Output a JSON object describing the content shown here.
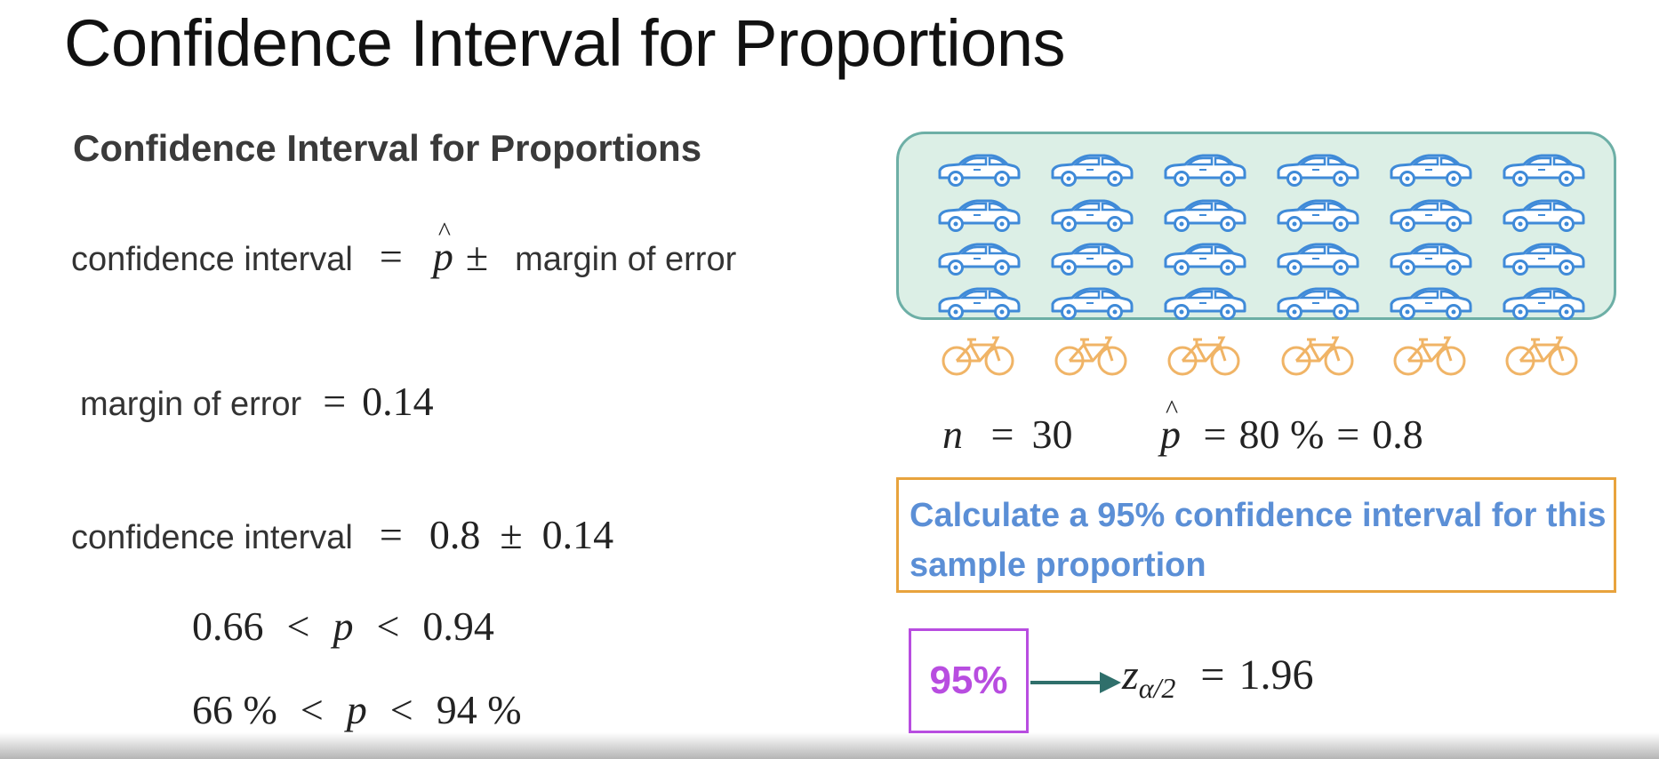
{
  "slide": {
    "title": "Confidence Interval for Proportions",
    "section_heading": "Confidence Interval for Proportions"
  },
  "formulas": {
    "ci_formula": {
      "lhs": "confidence interval",
      "eq": "=",
      "phat": "p",
      "pm": "±",
      "rhs": "margin of error"
    },
    "moe": {
      "lhs": "margin of error",
      "eq": "=",
      "value": "0.14"
    },
    "ci_values": {
      "lhs": "confidence interval",
      "eq": "=",
      "point": "0.8",
      "pm": "±",
      "moe": "0.14"
    },
    "ineq_decimal": {
      "lower": "0.66",
      "lt1": "<",
      "var": "p",
      "lt2": "<",
      "upper": "0.94"
    },
    "ineq_percent": {
      "lower": "66 %",
      "lt1": "<",
      "var": "p",
      "lt2": "<",
      "upper": "94 %"
    }
  },
  "sample": {
    "cars": 24,
    "bikes": 6,
    "car_icon": "car-icon",
    "bike_icon": "bicycle-icon",
    "car_color": "#3f8ad8",
    "bike_color": "#f0b466",
    "box_fill": "#dcefe6",
    "box_border": "#6dafa6",
    "n_label": "n",
    "n_eq": "=",
    "n_value": "30",
    "phat_label": "p",
    "phat_eq": "=",
    "phat_percent": "80 %",
    "phat_eq2": "=",
    "phat_value": "0.8"
  },
  "task": {
    "text": "Calculate a 95% confidence interval for this sample proportion",
    "border_color": "#e8a33d",
    "text_color": "#5b8fd6"
  },
  "critical_value": {
    "confidence_level": "95%",
    "z_symbol": "z",
    "z_subscript": "α/2",
    "eq": "=",
    "z_value": "1.96",
    "box_color": "#b84de0",
    "arrow_color": "#2f6f6b"
  }
}
